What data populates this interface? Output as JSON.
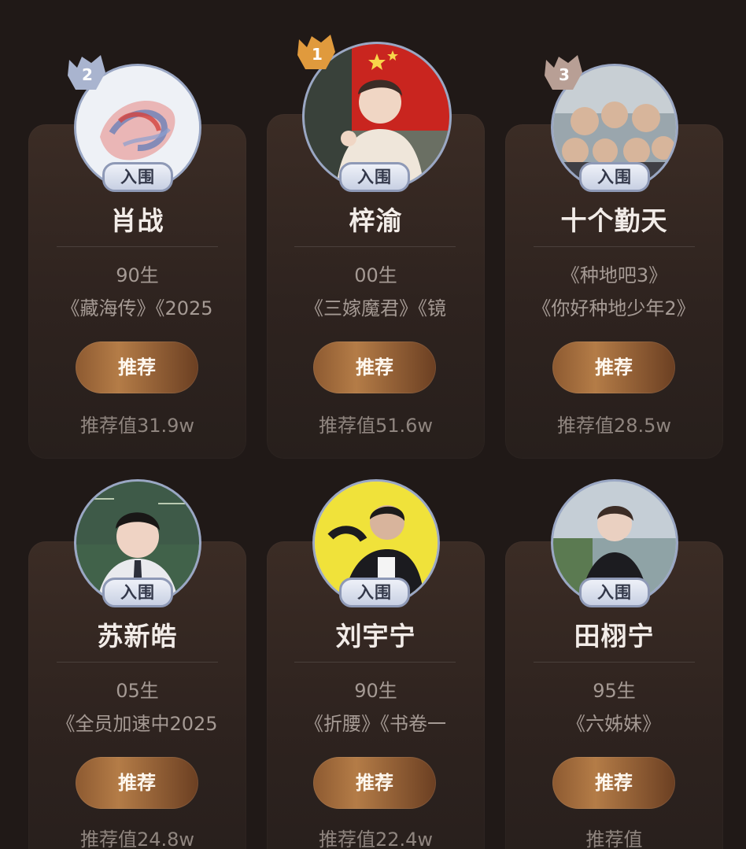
{
  "cards": [
    {
      "name": "肖战",
      "birth": "90生",
      "works": "《藏海传》《2025",
      "button_label": "推荐",
      "score": "推荐值31.9w",
      "badge": "入围",
      "rank": "2"
    },
    {
      "name": "梓渝",
      "birth": "00生",
      "works": "《三嫁魔君》《镜",
      "button_label": "推荐",
      "score": "推荐值51.6w",
      "badge": "入围",
      "rank": "1"
    },
    {
      "name": "十个勤天",
      "birth": "《种地吧3》",
      "works": "《你好种地少年2》",
      "button_label": "推荐",
      "score": "推荐值28.5w",
      "badge": "入围",
      "rank": "3"
    },
    {
      "name": "苏新皓",
      "birth": "05生",
      "works": "《全员加速中2025",
      "button_label": "推荐",
      "score": "推荐值24.8w",
      "badge": "入围",
      "rank": ""
    },
    {
      "name": "刘宇宁",
      "birth": "90生",
      "works": "《折腰》《书卷一",
      "button_label": "推荐",
      "score": "推荐值22.4w",
      "badge": "入围",
      "rank": ""
    },
    {
      "name": "田栩宁",
      "birth": "95生",
      "works": "《六姊妹》",
      "button_label": "推荐",
      "score": "推荐值",
      "badge": "入围",
      "rank": ""
    }
  ],
  "colors": {
    "background": "#201917",
    "card": "#332722",
    "button_gold": "#b47c47",
    "rank_gold": "#e09a3d",
    "rank_silver": "#a9b4cf",
    "rank_bronze": "#b89f95"
  }
}
